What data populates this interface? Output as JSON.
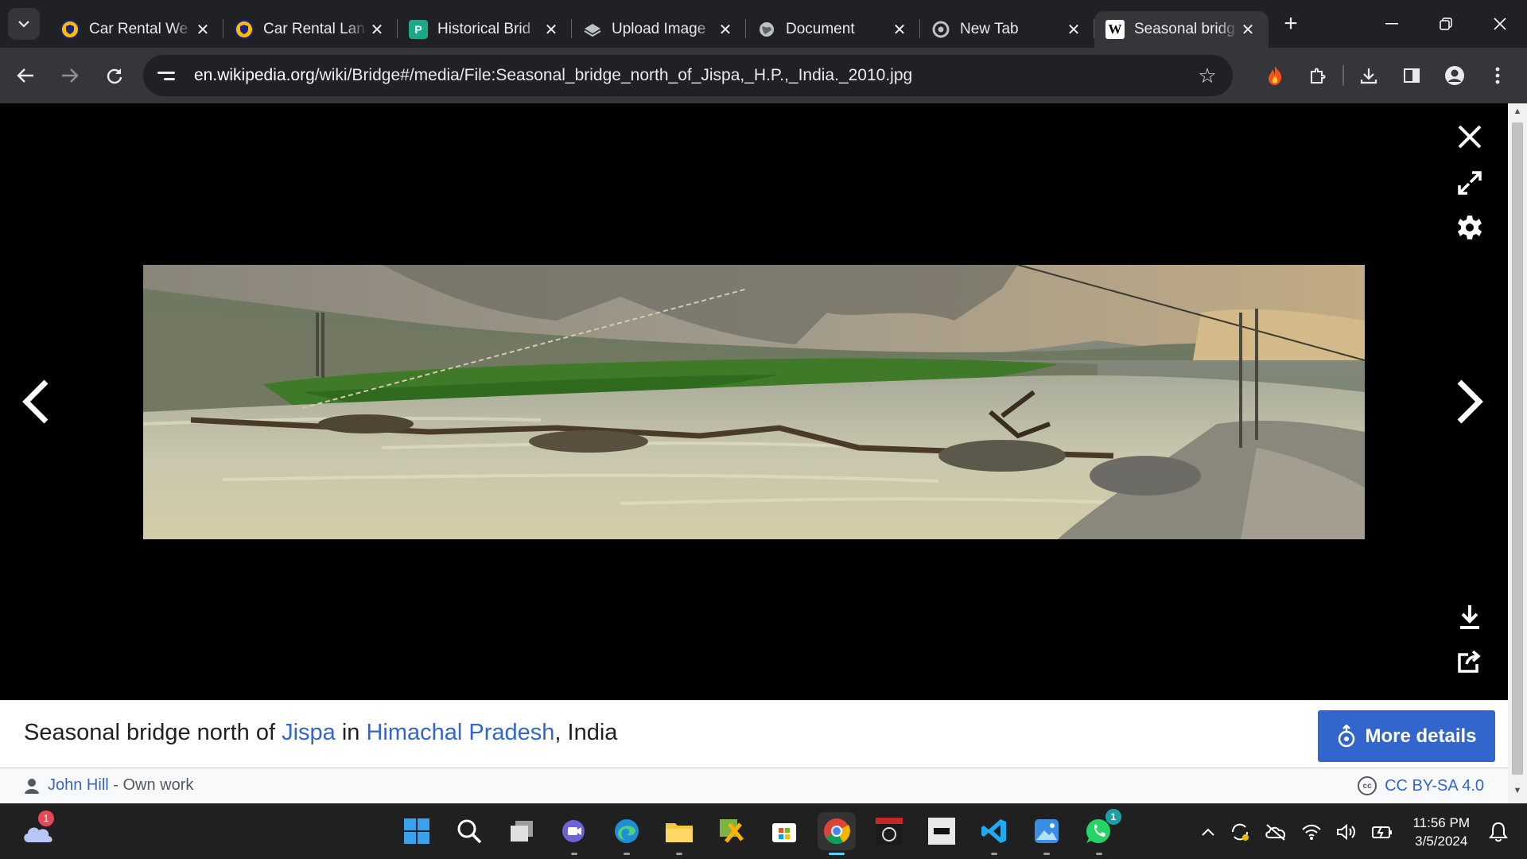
{
  "browser": {
    "tabs": [
      {
        "title": "Car Rental We",
        "favicon": "shield-icon",
        "active": false
      },
      {
        "title": "Car Rental Lan",
        "favicon": "shield-icon",
        "active": false
      },
      {
        "title": "Historical Brid",
        "favicon": "p-doc-icon",
        "active": false
      },
      {
        "title": "Upload Image",
        "favicon": "layers-icon",
        "active": false
      },
      {
        "title": "Document",
        "favicon": "globe-icon",
        "active": false
      },
      {
        "title": "New Tab",
        "favicon": "chrome-icon",
        "active": false
      },
      {
        "title": "Seasonal bridg",
        "favicon": "wikipedia-icon",
        "active": true
      }
    ],
    "url_host": "en.wikipedia.org",
    "url_path": "/wiki/Bridge#/media/File:Seasonal_bridge_north_of_Jispa,_H.P.,_India._2010.jpg",
    "wiki_favicon": "W"
  },
  "viewer": {
    "caption_prefix": "Seasonal bridge north of ",
    "caption_link1": "Jispa",
    "caption_mid": " in ",
    "caption_link2": "Himachal Pradesh",
    "caption_suffix": ", India",
    "more_details": "More details",
    "author": "John Hill",
    "author_suffix": " - Own work",
    "license": "CC BY-SA 4.0",
    "cc_mark": "cc"
  },
  "taskbar": {
    "weather_badge": "1",
    "whatsapp_badge": "1",
    "time": "11:56 PM",
    "date": "3/5/2024",
    "apps": [
      "windows-start",
      "search",
      "task-view",
      "teams",
      "edge",
      "file-explorer",
      "tool-app",
      "microsoft-store",
      "chrome",
      "pes-game",
      "fifa-game",
      "vscode",
      "photos",
      "whatsapp"
    ]
  },
  "colors": {
    "link": "#3366cc",
    "accent": "#3366cc",
    "taskbar": "#202020"
  }
}
